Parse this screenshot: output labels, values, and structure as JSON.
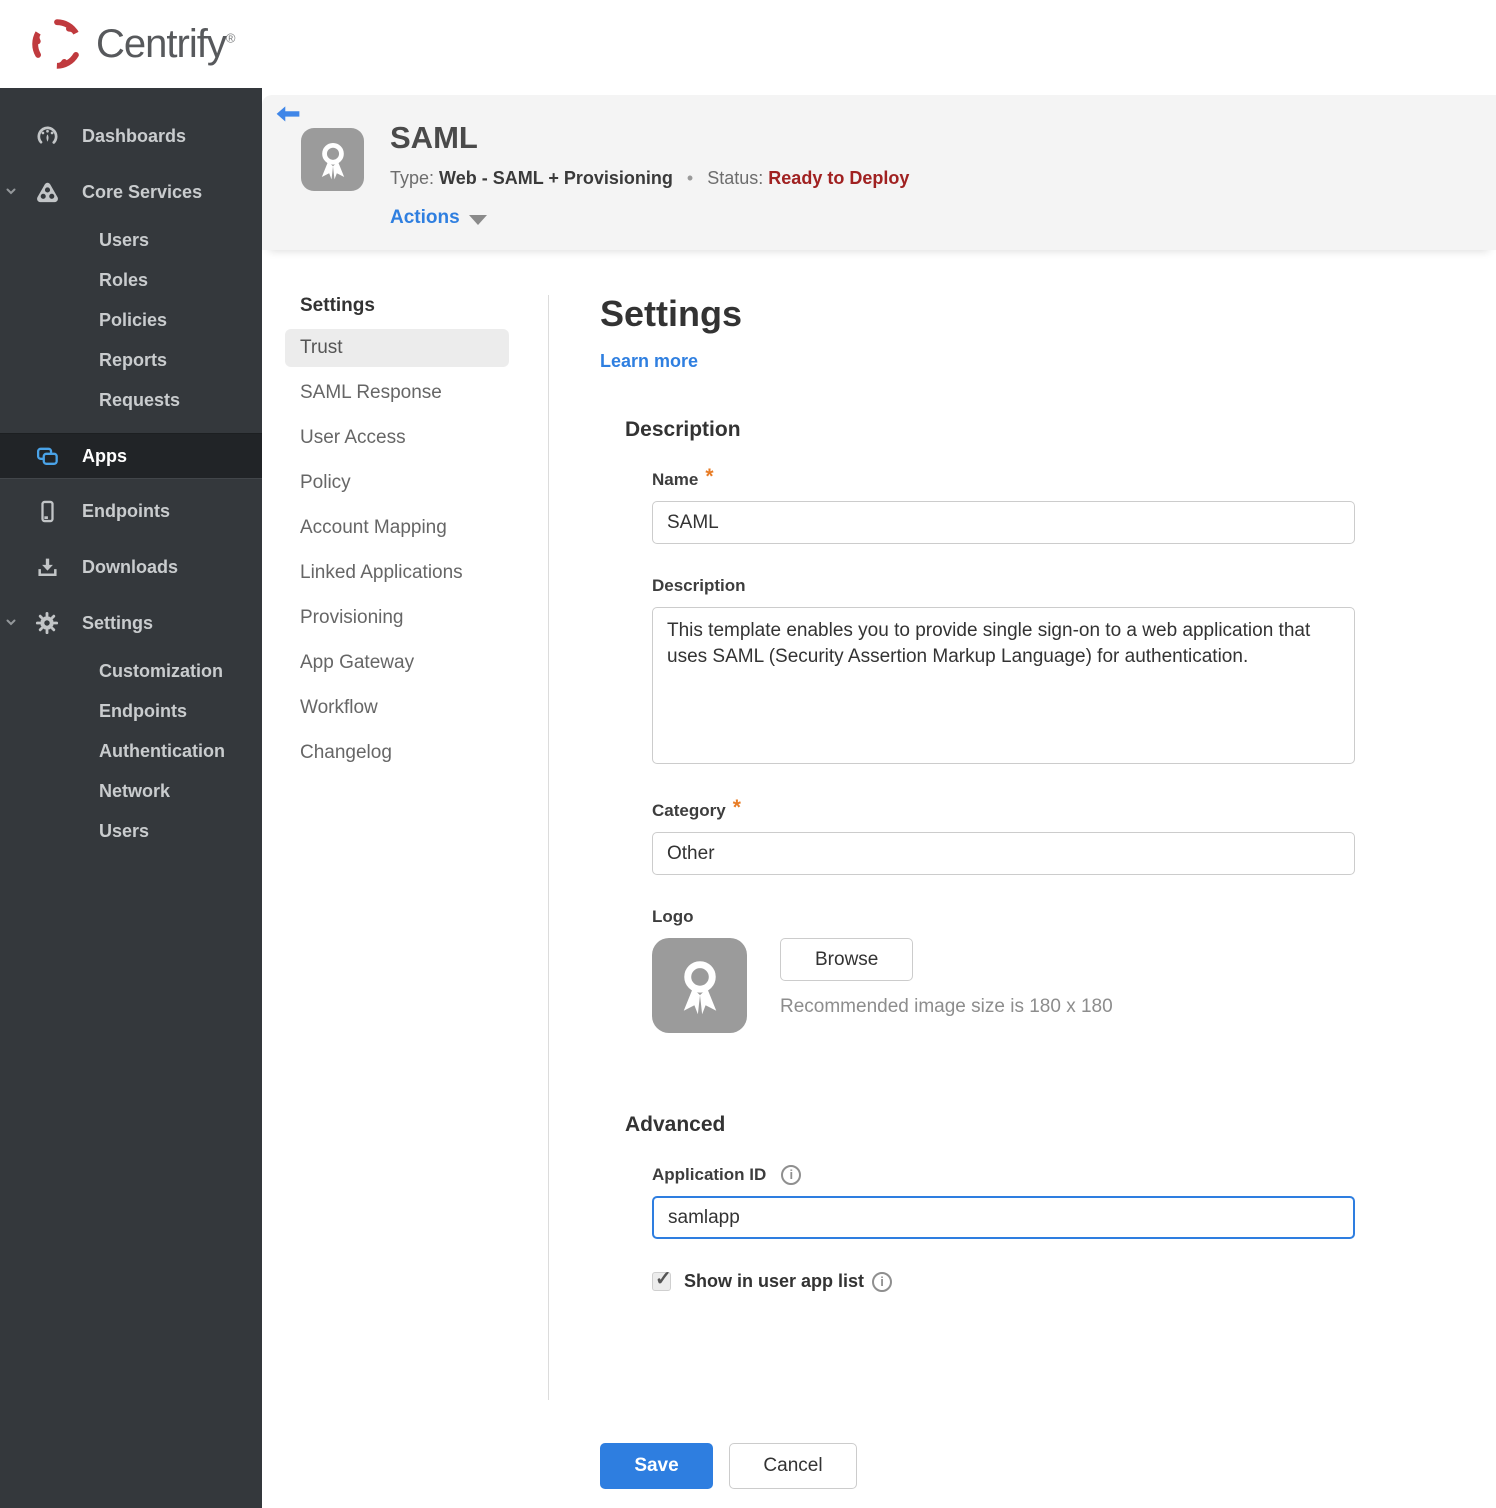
{
  "brand": {
    "name": "Centrify",
    "registered_mark": "®"
  },
  "sidebar": {
    "dashboards": "Dashboards",
    "core_services": "Core Services",
    "core_services_items": [
      "Users",
      "Roles",
      "Policies",
      "Reports",
      "Requests"
    ],
    "apps": "Apps",
    "endpoints": "Endpoints",
    "downloads": "Downloads",
    "settings": "Settings",
    "settings_items": [
      "Customization",
      "Endpoints",
      "Authentication",
      "Network",
      "Users"
    ]
  },
  "app_header": {
    "title": "SAML",
    "type_label": "Type:",
    "type_value": "Web - SAML + Provisioning",
    "bullet": "•",
    "status_label": "Status:",
    "status_value": "Ready to Deploy",
    "actions_label": "Actions"
  },
  "subnav": {
    "heading": "Settings",
    "items": [
      "Trust",
      "SAML Response",
      "User Access",
      "Policy",
      "Account Mapping",
      "Linked Applications",
      "Provisioning",
      "App Gateway",
      "Workflow",
      "Changelog"
    ],
    "selected_item": "Trust"
  },
  "content": {
    "heading": "Settings",
    "learn_more": "Learn more",
    "required_marker": "*",
    "description": {
      "heading": "Description",
      "name_label": "Name",
      "name_value": "SAML",
      "description_label": "Description",
      "description_value": "This template enables you to provide single sign-on to a web application that uses SAML (Security Assertion Markup Language) for authentication.",
      "category_label": "Category",
      "category_value": "Other",
      "logo_label": "Logo",
      "browse_label": "Browse",
      "logo_hint": "Recommended image size is 180 x 180"
    },
    "advanced": {
      "heading": "Advanced",
      "application_id_label": "Application ID",
      "application_id_value": "samlapp",
      "show_in_user_app_list_label": "Show in user app list",
      "show_in_user_app_list_checked": true
    },
    "save_label": "Save",
    "cancel_label": "Cancel"
  },
  "icons": {
    "check": "✓",
    "info": "i"
  },
  "colors": {
    "accent_blue": "#2f7fe0",
    "status_red": "#a02121",
    "required_orange": "#e87c25",
    "sidebar_bg": "#34383c",
    "brand_red": "#c03a3e"
  }
}
